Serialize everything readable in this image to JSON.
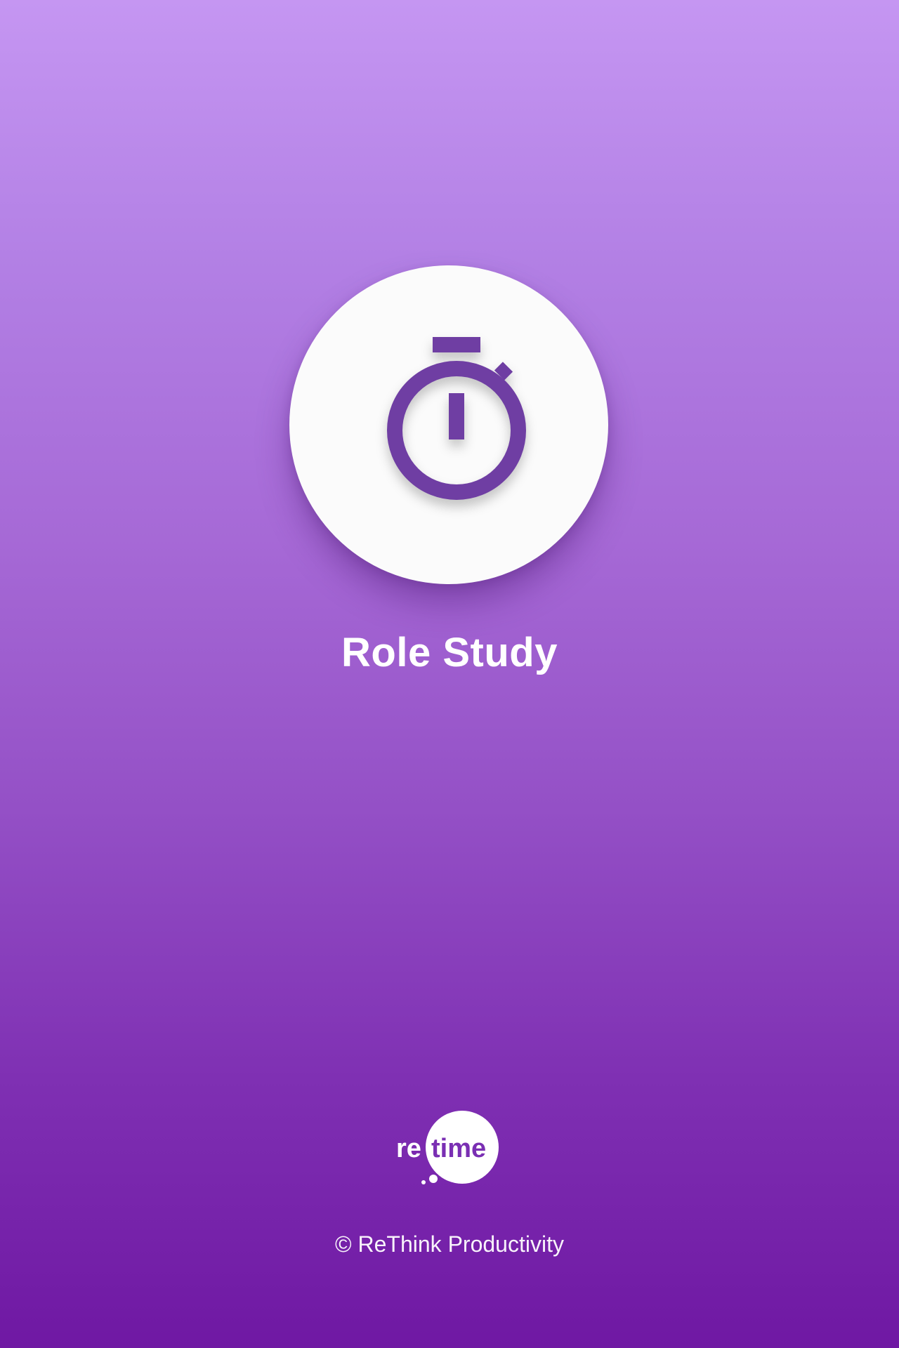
{
  "app": {
    "title": "Role Study",
    "icon": "stopwatch-icon",
    "accent_color": "#6f3ea3"
  },
  "brand": {
    "logo_text_left": "re",
    "logo_text_right": "time"
  },
  "footer": {
    "copyright": "© ReThink Productivity"
  },
  "colors": {
    "gradient_top": "#c596f2",
    "gradient_bottom": "#6f18a3",
    "icon_background": "#fbfbfb",
    "text": "#ffffff"
  }
}
